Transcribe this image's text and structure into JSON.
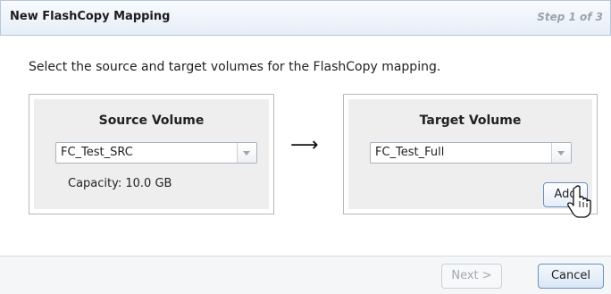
{
  "dialog": {
    "title": "New FlashCopy Mapping",
    "step": "Step 1 of 3",
    "instruction": "Select the source and target volumes for the FlashCopy mapping."
  },
  "source": {
    "label": "Source Volume",
    "selected": "FC_Test_SRC",
    "capacity": "Capacity: 10.0 GB"
  },
  "arrow": "⟶",
  "target": {
    "label": "Target Volume",
    "selected": "FC_Test_Full",
    "add_label": "Add"
  },
  "footer": {
    "next_label": "Next >",
    "cancel_label": "Cancel"
  }
}
